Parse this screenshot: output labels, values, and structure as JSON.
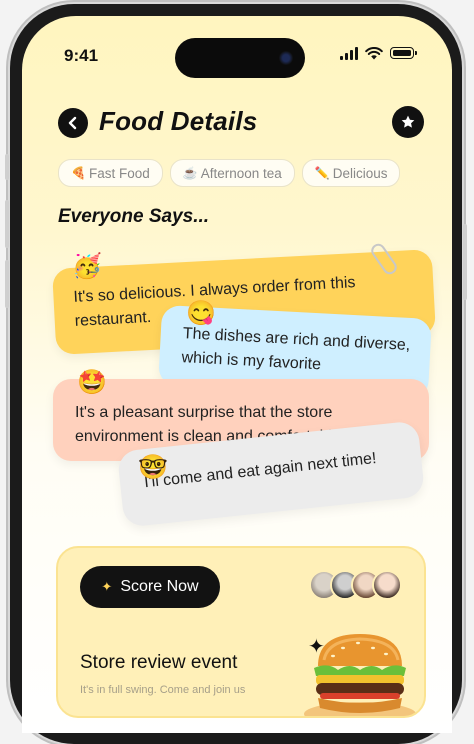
{
  "status_bar": {
    "time": "9:41"
  },
  "header": {
    "title": "Food Details"
  },
  "tags": [
    {
      "icon": "pizza-icon",
      "glyph": "🍕",
      "label": "Fast Food"
    },
    {
      "icon": "tea-icon",
      "glyph": "☕",
      "label": "Afternoon tea"
    },
    {
      "icon": "pencil-icon",
      "glyph": "✏️",
      "label": "Delicious"
    }
  ],
  "reviews": {
    "title": "Everyone Says...",
    "items": [
      {
        "emoji": "🥳",
        "text": "It's so delicious. I always order from this restaurant."
      },
      {
        "emoji": "😋",
        "text": "The dishes are rich and diverse, which is my favorite"
      },
      {
        "emoji": "🤩",
        "text": "It's a pleasant surprise that the store environment is clean and comfortable"
      },
      {
        "emoji": "🤓",
        "text": "I'll come and eat again next time!"
      }
    ]
  },
  "event_card": {
    "button_label": "Score Now",
    "title": "Store review event",
    "subtitle": "It's in full swing. Come and join us"
  },
  "colors": {
    "accent_yellow": "#ffd35a",
    "bubble_blue": "#cfefff",
    "bubble_peach": "#ffd1bd",
    "bubble_gray": "#ececec",
    "card_bg": "#fff0b8"
  }
}
